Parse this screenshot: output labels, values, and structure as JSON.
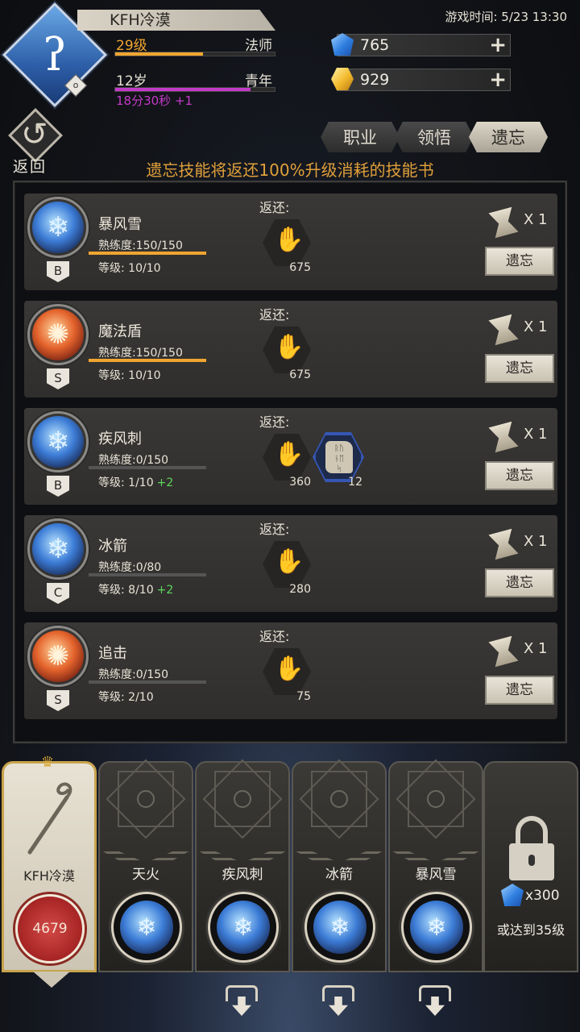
{
  "header": {
    "player_name": "KFH冷漠",
    "level_label": "29级",
    "class_label": "法师",
    "level_progress": 0.55,
    "age_label": "12岁",
    "age_stage": "青年",
    "age_progress": 0.85,
    "age_timer": "18分30秒 +1",
    "avatar_badge": "o",
    "game_time": "游戏时间: 5/23 13:30",
    "currency_gems": "765",
    "currency_gold": "929"
  },
  "nav": {
    "back_label": "返回",
    "tabs": [
      {
        "label": "职业",
        "active": false
      },
      {
        "label": "领悟",
        "active": false
      },
      {
        "label": "遗忘",
        "active": true
      }
    ]
  },
  "subtitle": "遗忘技能将返还100%升级消耗的技能书",
  "labels": {
    "return_label": "返还:",
    "forget_button": "遗忘",
    "cost_label": "X 1"
  },
  "skills": [
    {
      "name": "暴风雪",
      "rank": "B",
      "proficiency": "熟练度:150/150",
      "proficiency_ratio": 1.0,
      "level": "等级: 10/10",
      "bonus": "",
      "element": "ice",
      "returns": [
        {
          "type": "scroll",
          "count": "675"
        }
      ]
    },
    {
      "name": "魔法盾",
      "rank": "S",
      "proficiency": "熟练度:150/150",
      "proficiency_ratio": 1.0,
      "level": "等级: 10/10",
      "bonus": "",
      "element": "fire",
      "returns": [
        {
          "type": "scroll",
          "count": "675"
        }
      ]
    },
    {
      "name": "疾风刺",
      "rank": "B",
      "proficiency": "熟练度:0/150",
      "proficiency_ratio": 0.0,
      "level": "等级: 1/10",
      "bonus": "+2",
      "element": "ice",
      "returns": [
        {
          "type": "scroll",
          "count": "360"
        },
        {
          "type": "rune",
          "count": "12"
        }
      ]
    },
    {
      "name": "冰箭",
      "rank": "C",
      "proficiency": "熟练度:0/80",
      "proficiency_ratio": 0.0,
      "level": "等级: 8/10",
      "bonus": "+2",
      "element": "ice",
      "returns": [
        {
          "type": "scroll",
          "count": "280"
        }
      ]
    },
    {
      "name": "追击",
      "rank": "S",
      "proficiency": "熟练度:0/150",
      "proficiency_ratio": 0.0,
      "level": "等级: 2/10",
      "bonus": "",
      "element": "fire",
      "returns": [
        {
          "type": "scroll",
          "count": "75"
        }
      ]
    }
  ],
  "skill_bar": {
    "main": {
      "name": "KFH冷漠",
      "power": "4679"
    },
    "slots": [
      {
        "name": "天火",
        "element": "ice"
      },
      {
        "name": "疾风刺",
        "element": "ice"
      },
      {
        "name": "冰箭",
        "element": "ice"
      },
      {
        "name": "暴风雪",
        "element": "ice"
      }
    ],
    "locked": {
      "cost": "x300",
      "requirement": "或达到35级"
    }
  },
  "colors": {
    "accent_orange": "#e0a03a",
    "proficiency_bar": "#f0a531",
    "bonus_green": "#5cd65c",
    "level_bar": "#f0a531",
    "age_bar": "#c43ac8"
  }
}
